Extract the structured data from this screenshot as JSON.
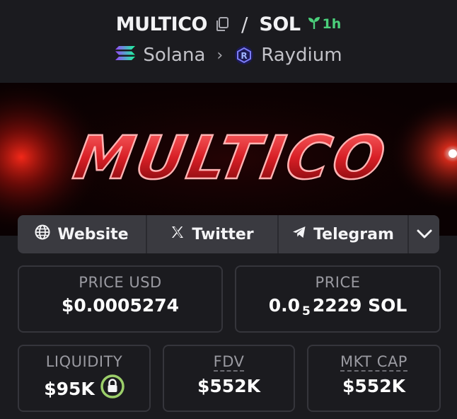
{
  "header": {
    "symbol": "MULTICO",
    "quote": "SOL",
    "separator": "/",
    "age": "1h",
    "chain": "Solana",
    "dex": "Raydium"
  },
  "banner": {
    "text": "MULTICO"
  },
  "social": {
    "website": "Website",
    "twitter": "Twitter",
    "telegram": "Telegram"
  },
  "stats": {
    "price_usd_label": "PRICE USD",
    "price_usd": "$0.0005274",
    "price_label": "PRICE",
    "price_prefix": "0.0",
    "price_zeros": "5",
    "price_rest": "2229 SOL",
    "liquidity_label": "LIQUIDITY",
    "liquidity": "$95K",
    "fdv_label": "FDV",
    "fdv": "$552K",
    "mktcap_label": "MKT CAP",
    "mktcap": "$552K"
  },
  "colors": {
    "accent_green": "#4bd07b",
    "background": "#1b1b1f",
    "lock_ring": "#9ccf6a"
  }
}
